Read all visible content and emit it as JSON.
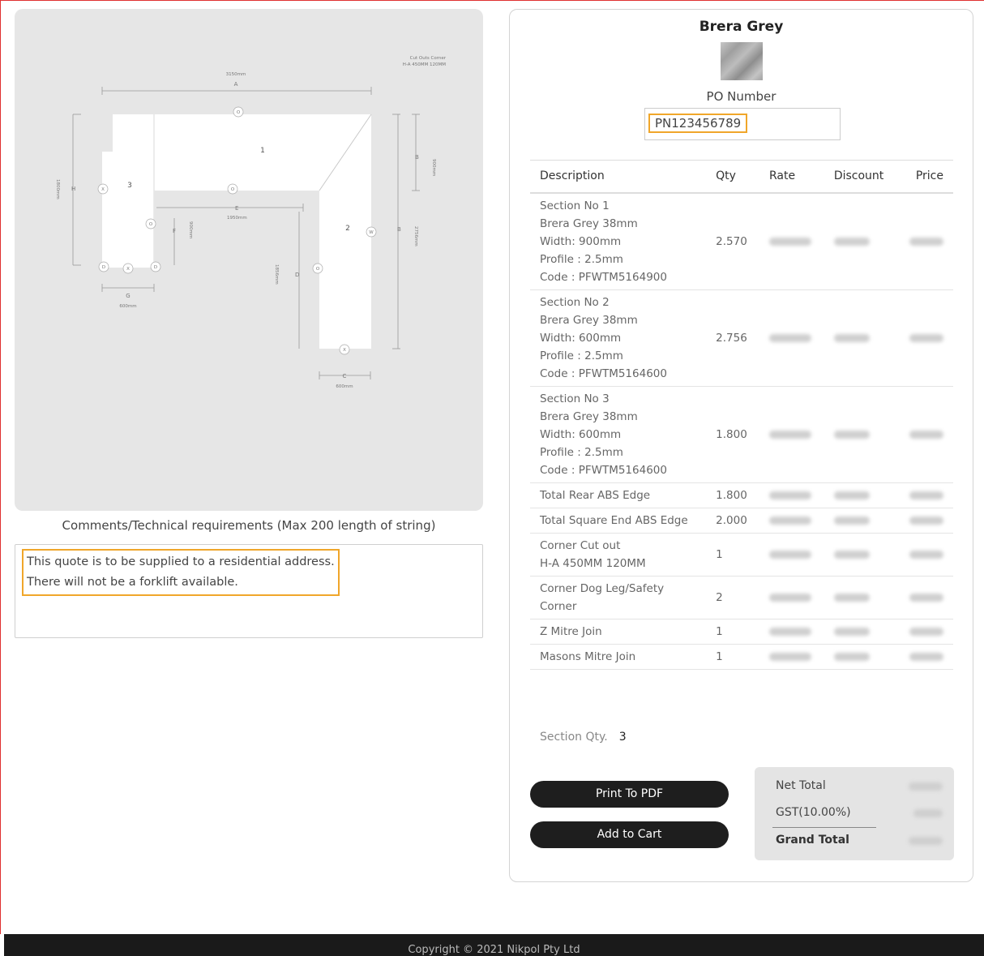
{
  "diagram": {
    "note_line1": "Cut Outs Corner",
    "note_line2": "H-A 450MM 120MM",
    "dim_a": "3150mm",
    "label_a": "A",
    "label_b": "B",
    "dim_b_top": "900mm",
    "dim_b": "2756mm",
    "label_b2": "B",
    "dim_h": "1800mm",
    "label_h": "H",
    "label_e": "E",
    "dim_e": "1950mm",
    "label_f": "F",
    "dim_f": "900mm",
    "label_d": "D",
    "dim_d": "1856mm",
    "label_g": "G",
    "dim_g": "600mm",
    "label_c": "C",
    "dim_c": "600mm",
    "section_1": "1",
    "section_2": "2",
    "section_3": "3",
    "mark_o": "O",
    "mark_x": "X",
    "mark_d": "D",
    "mark_w": "W"
  },
  "comments": {
    "label": "Comments/Technical requirements (Max 200 length of string)",
    "line1": "This quote is to be supplied to a residential address.",
    "line2": "There will not be a forklift available."
  },
  "product": {
    "title": "Brera Grey",
    "po_label": "PO Number",
    "po_value": "PN123456789"
  },
  "table": {
    "headers": [
      "Description",
      "Qty",
      "Rate",
      "Discount",
      "Price"
    ],
    "rows": [
      {
        "lines": [
          "Section No 1",
          "Brera Grey 38mm",
          "Width: 900mm",
          "Profile : 2.5mm",
          "Code : PFWTM5164900"
        ],
        "qty": "2.570"
      },
      {
        "lines": [
          "Section No 2",
          "Brera Grey 38mm",
          "Width: 600mm",
          "Profile : 2.5mm",
          "Code : PFWTM5164600"
        ],
        "qty": "2.756"
      },
      {
        "lines": [
          "Section No 3",
          "Brera Grey 38mm",
          "Width: 600mm",
          "Profile : 2.5mm",
          "Code : PFWTM5164600"
        ],
        "qty": "1.800"
      },
      {
        "lines": [
          "Total Rear ABS Edge"
        ],
        "qty": "1.800"
      },
      {
        "lines": [
          "Total Square End ABS Edge"
        ],
        "qty": "2.000"
      },
      {
        "lines": [
          "Corner Cut out",
          "H-A 450MM 120MM"
        ],
        "qty": "1"
      },
      {
        "lines": [
          "Corner Dog Leg/Safety",
          "Corner"
        ],
        "qty": "2"
      },
      {
        "lines": [
          "Z Mitre Join"
        ],
        "qty": "1"
      },
      {
        "lines": [
          "Masons Mitre Join"
        ],
        "qty": "1"
      }
    ],
    "section_qty_label": "Section Qty.",
    "section_qty_value": "3"
  },
  "buttons": {
    "print_pdf": "Print To PDF",
    "add_to_cart": "Add to Cart"
  },
  "totals": {
    "net_total_label": "Net Total",
    "gst_label": "GST(10.00%)",
    "grand_total_label": "Grand Total"
  },
  "footer": {
    "copyright": "Copyright © 2021 Nikpol Pty Ltd"
  },
  "colors": {
    "highlight": "#f0a62a",
    "button_bg": "#1e1e1e",
    "footer_bg": "#1a1a1a",
    "diagram_bg": "#e6e6e6"
  }
}
